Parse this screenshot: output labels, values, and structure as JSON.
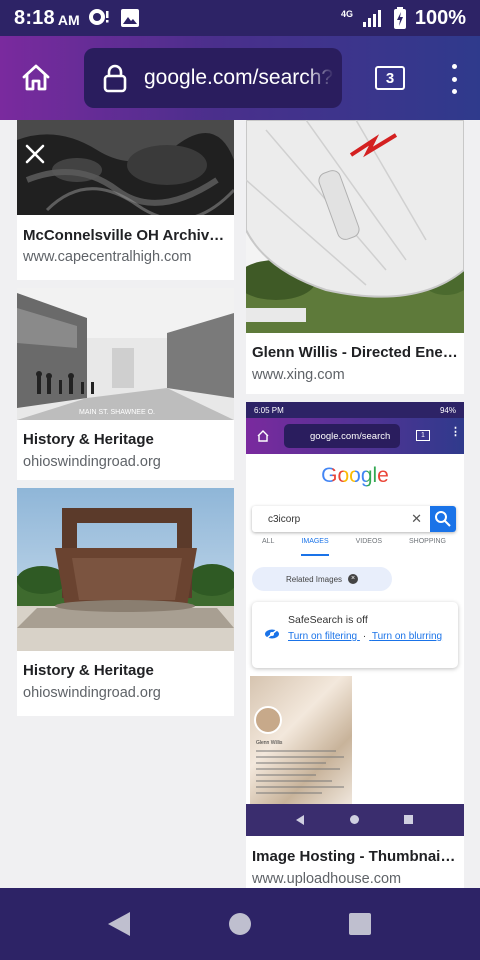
{
  "status_bar": {
    "time": "8:18",
    "ampm": "AM",
    "network": "4G",
    "battery": "100%"
  },
  "browser": {
    "url": "google.com/search?",
    "tab_count": "3"
  },
  "results": [
    {
      "title": "McConnelsville OH Archive…",
      "source": "www.capecentralhigh.com"
    },
    {
      "title": "History & Heritage",
      "source": "ohioswindingroad.org",
      "caption": "MAIN ST. SHAWNEE O."
    },
    {
      "title": "History & Heritage",
      "source": "ohioswindingroad.org"
    },
    {
      "title": "Glenn Willis - Directed Ener…",
      "source": "www.xing.com"
    },
    {
      "title": "Image Hosting - Thumbnail …",
      "source": "www.uploadhouse.com"
    }
  ],
  "nested_screenshot": {
    "time": "6:05 PM",
    "battery": "94%",
    "url": "google.com/search",
    "tab_count": "1",
    "logo": "Google",
    "query": "c3icorp",
    "tabs": [
      "ALL",
      "IMAGES",
      "VIDEOS",
      "SHOPPING"
    ],
    "related": "Related Images",
    "safesearch_title": "SafeSearch is off",
    "safesearch_link1": "Turn on filtering",
    "safesearch_sep": "·",
    "safesearch_link2": "Turn on blurring",
    "profile_name": "Glenn Willis"
  },
  "colors": {
    "status_bar": "#2d2366",
    "toolbar_start": "#7a2a9e",
    "toolbar_end": "#2f3a8c",
    "url_box": "#2a1d5e",
    "link": "#1a73e8"
  }
}
